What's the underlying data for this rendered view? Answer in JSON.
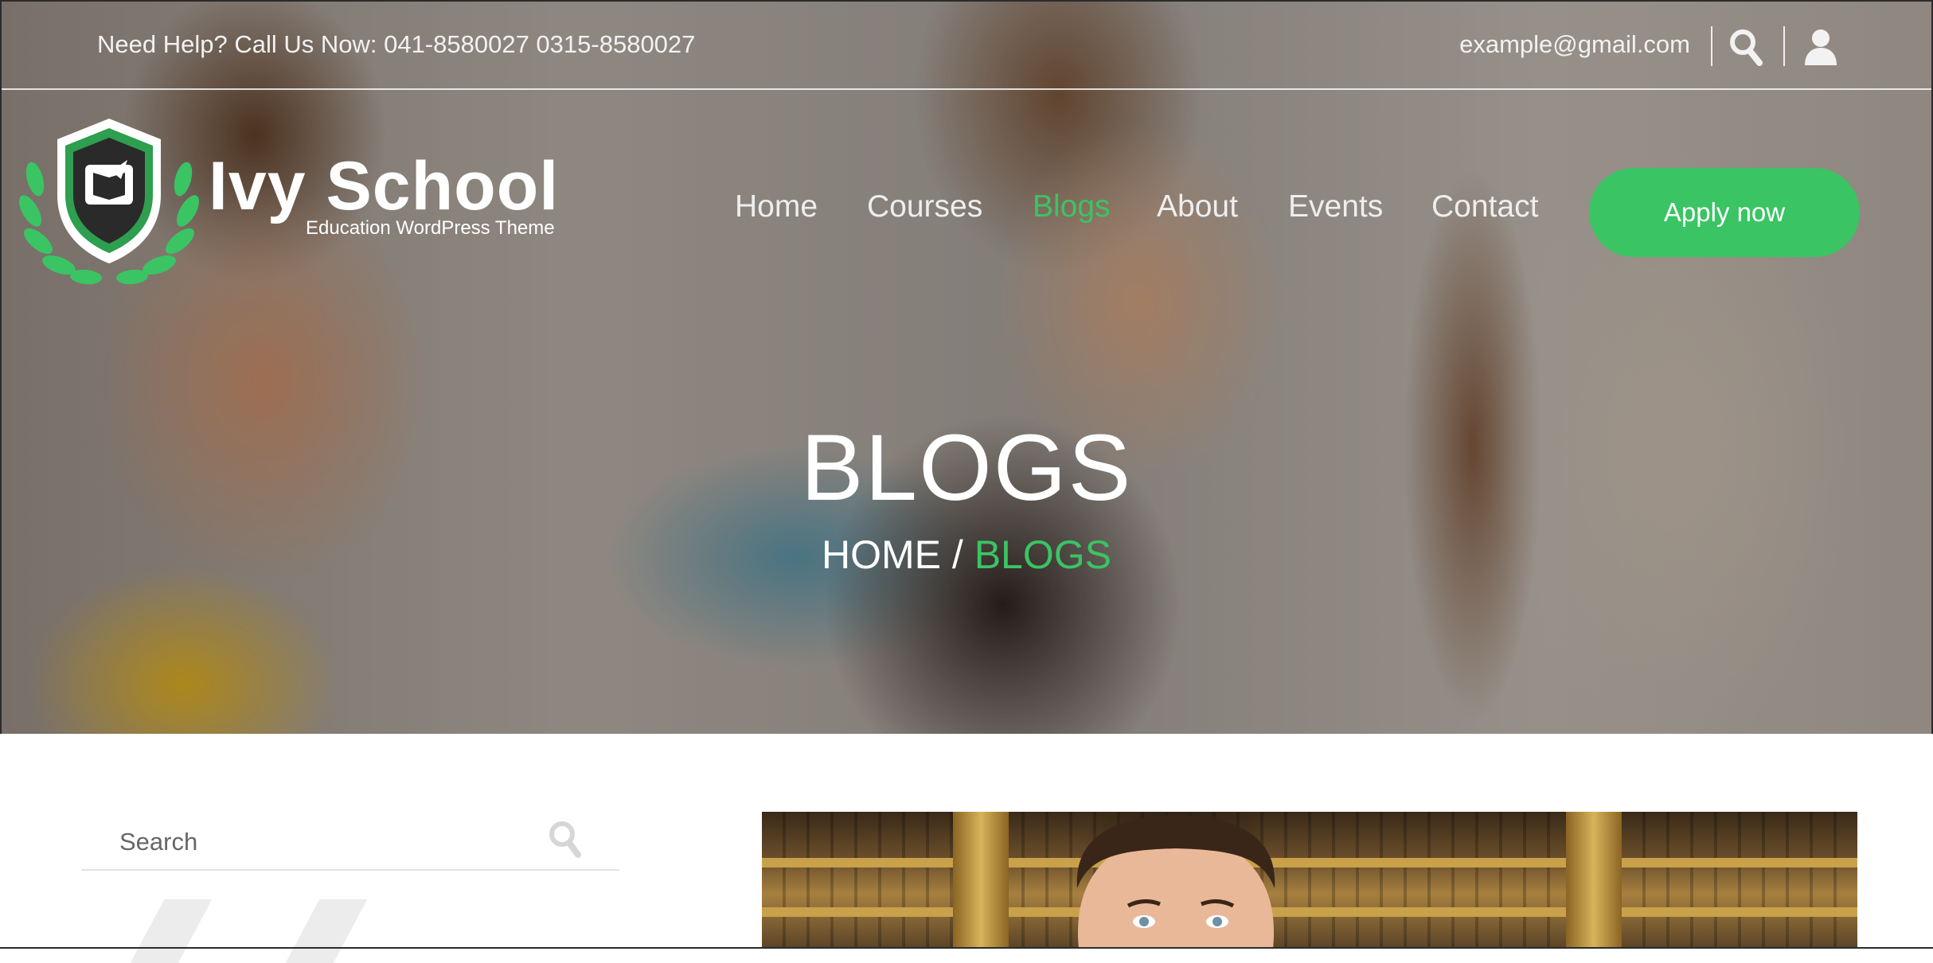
{
  "topbar": {
    "help_text": "Need Help? Call Us Now: 041-8580027 0315-8580027",
    "email": "example@gmail.com",
    "search_icon": "search-icon",
    "user_icon": "user-icon"
  },
  "logo": {
    "title": "Ivy School",
    "subtitle": "Education WordPress Theme"
  },
  "nav": {
    "items": [
      {
        "label": "Home"
      },
      {
        "label": "Courses"
      },
      {
        "label": "Blogs"
      },
      {
        "label": "About"
      },
      {
        "label": "Events"
      },
      {
        "label": "Contact"
      }
    ],
    "active": "Blogs",
    "apply_label": "Apply now"
  },
  "hero": {
    "title": "BLOGS",
    "breadcrumb_home": "HOME",
    "breadcrumb_sep": "/",
    "breadcrumb_current": "BLOGS"
  },
  "sidebar": {
    "search_placeholder": "Search"
  },
  "colors": {
    "accent": "#3ac464",
    "text_light": "#ffffff"
  }
}
